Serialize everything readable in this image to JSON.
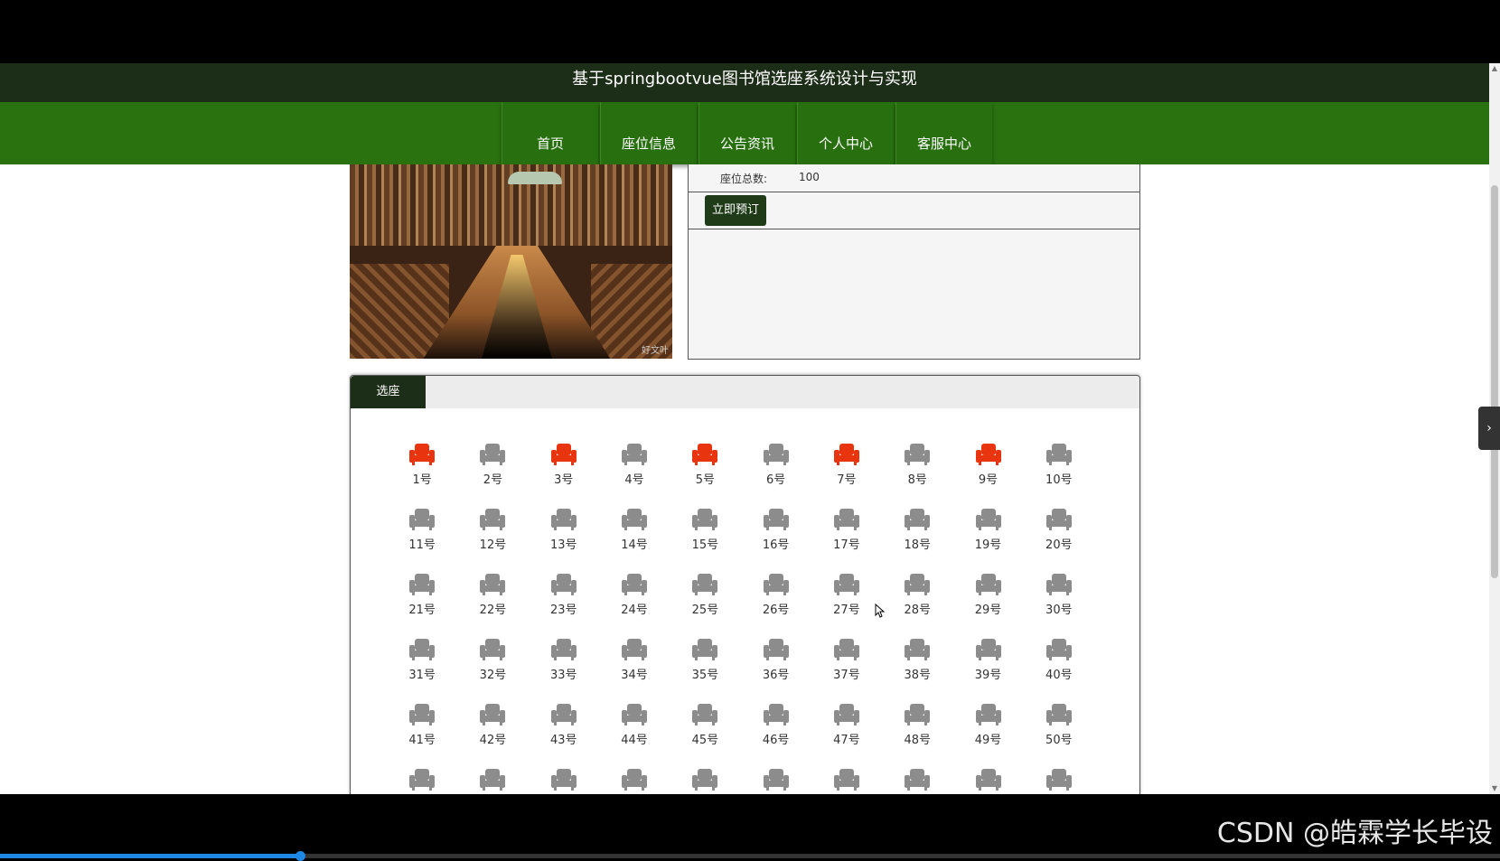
{
  "app": {
    "title": "基于springbootvue图书馆选座系统设计与实现"
  },
  "nav": {
    "items": [
      {
        "label": "首页"
      },
      {
        "label": "座位信息"
      },
      {
        "label": "公告资讯"
      },
      {
        "label": "个人中心"
      },
      {
        "label": "客服中心"
      }
    ]
  },
  "detail": {
    "seat_total_label": "座位总数:",
    "seat_total_value": "100",
    "book_button": "立即预订",
    "photo_watermark": "好文叶"
  },
  "seat_panel": {
    "tab_label": "选座",
    "seats": [
      {
        "label": "1号",
        "status": "occupied"
      },
      {
        "label": "2号",
        "status": "free"
      },
      {
        "label": "3号",
        "status": "occupied"
      },
      {
        "label": "4号",
        "status": "free"
      },
      {
        "label": "5号",
        "status": "occupied"
      },
      {
        "label": "6号",
        "status": "free"
      },
      {
        "label": "7号",
        "status": "occupied"
      },
      {
        "label": "8号",
        "status": "free"
      },
      {
        "label": "9号",
        "status": "occupied"
      },
      {
        "label": "10号",
        "status": "free"
      },
      {
        "label": "11号",
        "status": "free"
      },
      {
        "label": "12号",
        "status": "free"
      },
      {
        "label": "13号",
        "status": "free"
      },
      {
        "label": "14号",
        "status": "free"
      },
      {
        "label": "15号",
        "status": "free"
      },
      {
        "label": "16号",
        "status": "free"
      },
      {
        "label": "17号",
        "status": "free"
      },
      {
        "label": "18号",
        "status": "free"
      },
      {
        "label": "19号",
        "status": "free"
      },
      {
        "label": "20号",
        "status": "free"
      },
      {
        "label": "21号",
        "status": "free"
      },
      {
        "label": "22号",
        "status": "free"
      },
      {
        "label": "23号",
        "status": "free"
      },
      {
        "label": "24号",
        "status": "free"
      },
      {
        "label": "25号",
        "status": "free"
      },
      {
        "label": "26号",
        "status": "free"
      },
      {
        "label": "27号",
        "status": "free"
      },
      {
        "label": "28号",
        "status": "free"
      },
      {
        "label": "29号",
        "status": "free"
      },
      {
        "label": "30号",
        "status": "free"
      },
      {
        "label": "31号",
        "status": "free"
      },
      {
        "label": "32号",
        "status": "free"
      },
      {
        "label": "33号",
        "status": "free"
      },
      {
        "label": "34号",
        "status": "free"
      },
      {
        "label": "35号",
        "status": "free"
      },
      {
        "label": "36号",
        "status": "free"
      },
      {
        "label": "37号",
        "status": "free"
      },
      {
        "label": "38号",
        "status": "free"
      },
      {
        "label": "39号",
        "status": "free"
      },
      {
        "label": "40号",
        "status": "free"
      },
      {
        "label": "41号",
        "status": "free"
      },
      {
        "label": "42号",
        "status": "free"
      },
      {
        "label": "43号",
        "status": "free"
      },
      {
        "label": "44号",
        "status": "free"
      },
      {
        "label": "45号",
        "status": "free"
      },
      {
        "label": "46号",
        "status": "free"
      },
      {
        "label": "47号",
        "status": "free"
      },
      {
        "label": "48号",
        "status": "free"
      },
      {
        "label": "49号",
        "status": "free"
      },
      {
        "label": "50号",
        "status": "free"
      },
      {
        "label": "",
        "status": "free"
      },
      {
        "label": "",
        "status": "free"
      },
      {
        "label": "",
        "status": "free"
      },
      {
        "label": "",
        "status": "free"
      },
      {
        "label": "",
        "status": "free"
      },
      {
        "label": "",
        "status": "free"
      },
      {
        "label": "",
        "status": "free"
      },
      {
        "label": "",
        "status": "free"
      },
      {
        "label": "",
        "status": "free"
      },
      {
        "label": "",
        "status": "free"
      }
    ]
  },
  "colors": {
    "occupied": "#e8350f",
    "free": "#8c8c8c",
    "nav_green": "#2a7110",
    "header_dark": "#1d2e18"
  },
  "video": {
    "progress": 0.2
  },
  "watermark": "CSDN @皓霖学长毕设",
  "side_tab_icon": "chevron-right-icon"
}
